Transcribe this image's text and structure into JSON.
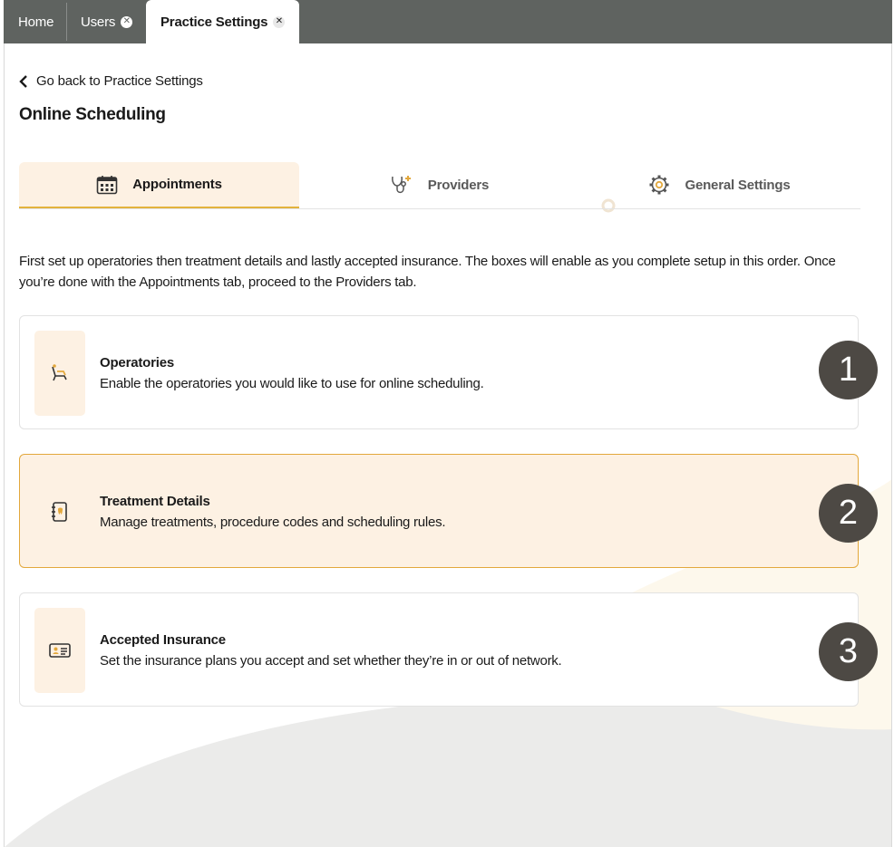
{
  "top_tabs": [
    {
      "label": "Home"
    },
    {
      "label": "Users",
      "close": "✕"
    },
    {
      "label": "Practice Settings",
      "close": "✕"
    }
  ],
  "back_link": "Go back to Practice Settings",
  "page_title": "Online Scheduling",
  "sub_tabs": [
    {
      "label": "Appointments",
      "icon": "calendar-icon",
      "active": true
    },
    {
      "label": "Providers",
      "icon": "stethoscope-icon",
      "active": false
    },
    {
      "label": "General Settings",
      "icon": "gear-icon",
      "active": false
    }
  ],
  "intro": "First set up operatories then treatment details and lastly accepted insurance. The boxes will enable as you complete setup in this order. Once you’re done with the Appointments tab, proceed to the Providers tab.",
  "cards": [
    {
      "number": "1",
      "title": "Operatories",
      "description": "Enable the operatories you would like to use for online scheduling.",
      "icon": "dental-chair-icon"
    },
    {
      "number": "2",
      "title": "Treatment Details",
      "description": "Manage treatments, procedure codes and scheduling rules.",
      "icon": "tooth-notebook-icon"
    },
    {
      "number": "3",
      "title": "Accepted Insurance",
      "description": "Set the insurance plans you accept and set whether they’re in or out of network.",
      "icon": "insurance-card-icon"
    }
  ],
  "colors": {
    "accent": "#e3b23c",
    "highlight_bg": "#fdf1e3",
    "topbar": "#5f6360",
    "badge": "#4d4944"
  }
}
